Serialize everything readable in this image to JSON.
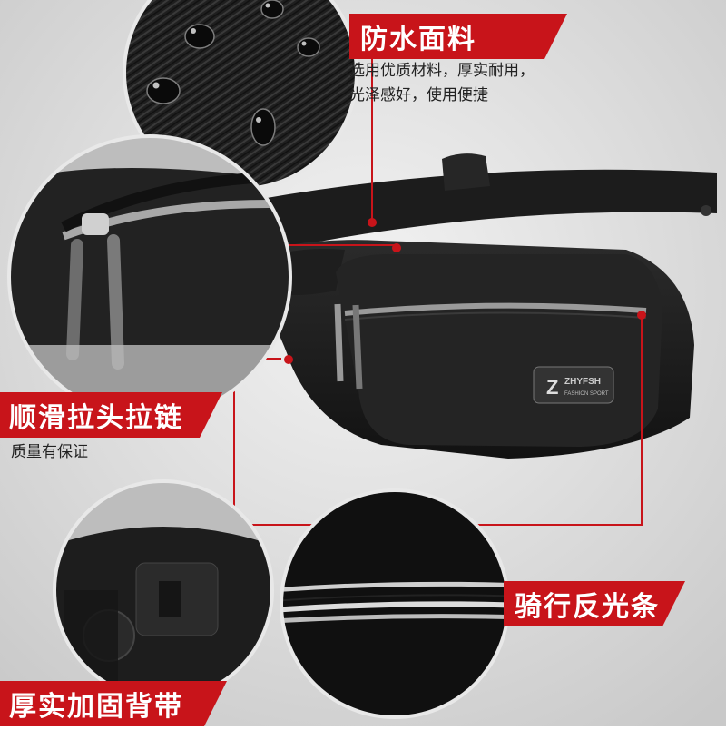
{
  "colors": {
    "accent": "#c8141a",
    "dark": "#1a1a1a",
    "bg": "#d9d9d9"
  },
  "features": {
    "waterproof": {
      "title": "防水面料",
      "desc_lines": [
        "选用优质材料，厚实耐用，",
        "光泽感好，使用便捷"
      ]
    },
    "zipper": {
      "title": "顺滑拉头拉链",
      "desc": "质量有保证"
    },
    "reflective": {
      "title": "骑行反光条"
    },
    "strap": {
      "title": "厚实加固背带"
    }
  },
  "bag": {
    "logo_letter": "Z",
    "brand": "ZHYFSH",
    "sub": "FASHION SPORT"
  }
}
